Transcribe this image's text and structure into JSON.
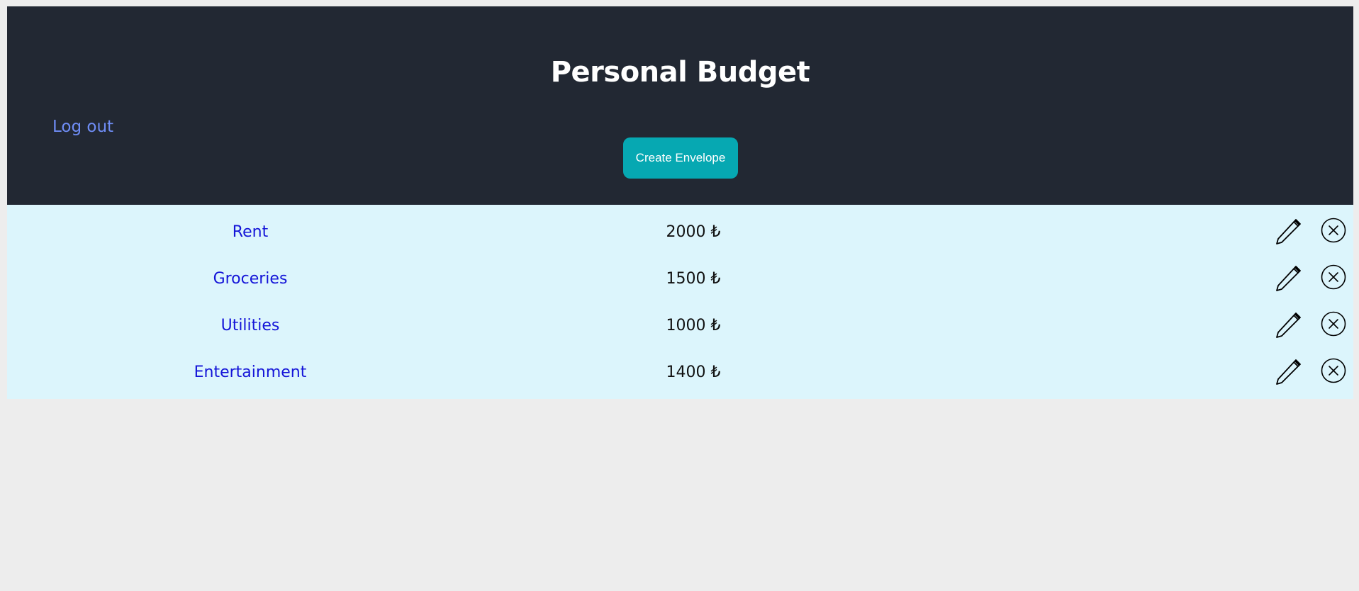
{
  "header": {
    "title": "Personal Budget",
    "logout_label": "Log out",
    "create_label": "Create Envelope"
  },
  "envelopes": [
    {
      "name": "Rent",
      "amount": "2000 ₺"
    },
    {
      "name": "Groceries",
      "amount": "1500 ₺"
    },
    {
      "name": "Utilities",
      "amount": "1000 ₺"
    },
    {
      "name": "Entertainment",
      "amount": "1400 ₺"
    }
  ],
  "icons": {
    "edit": "pencil-icon",
    "delete": "close-circle-icon"
  },
  "colors": {
    "header_bg": "#222833",
    "list_bg": "#dcf5fc",
    "button_bg": "#06a8b2",
    "link": "#1414d8",
    "logout": "#6f8df6"
  }
}
